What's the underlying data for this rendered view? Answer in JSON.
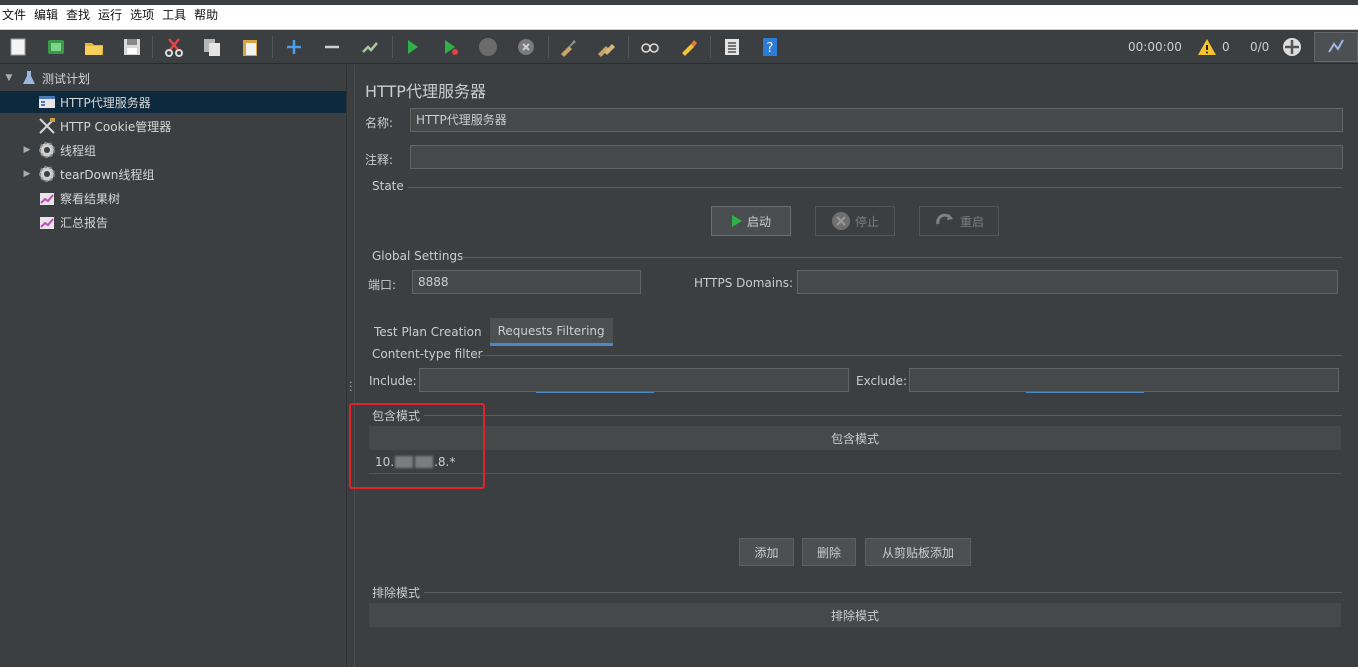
{
  "menu": [
    "文件",
    "编辑",
    "查找",
    "运行",
    "选项",
    "工具",
    "帮助"
  ],
  "toolbar_status": {
    "timer": "00:00:00",
    "warnings": "0",
    "threads": "0/0"
  },
  "tree": {
    "root": "测试计划",
    "items": [
      {
        "label": "HTTP代理服务器",
        "icon": "proxy-server-icon"
      },
      {
        "label": "HTTP Cookie管理器",
        "icon": "tools-icon"
      },
      {
        "label": "线程组",
        "icon": "gear-icon"
      },
      {
        "label": "tearDown线程组",
        "icon": "gear-icon"
      },
      {
        "label": "察看结果树",
        "icon": "chart-icon"
      },
      {
        "label": "汇总报告",
        "icon": "chart-icon"
      }
    ]
  },
  "panel": {
    "title": "HTTP代理服务器",
    "name_label": "名称:",
    "name_value": "HTTP代理服务器",
    "comment_label": "注释:",
    "comment_value": "",
    "state_label": "State",
    "start_label": "启动",
    "stop_label": "停止",
    "restart_label": "重启",
    "global_label": "Global Settings",
    "port_label": "端口:",
    "port_value": "8888",
    "https_label": "HTTPS Domains:",
    "https_value": "",
    "tabs": [
      "Test Plan Creation",
      "Requests Filtering"
    ],
    "content_filter_label": "Content-type filter",
    "include_label": "Include:",
    "include_value": "",
    "exclude_label": "Exclude:",
    "exclude_value": "",
    "include_patterns_label": "包含模式",
    "include_patterns_header": "包含模式",
    "include_pattern_prefix": "10.",
    "include_pattern_suffix": ".8.*",
    "add_label": "添加",
    "delete_label": "删除",
    "paste_label": "从剪贴板添加",
    "exclude_patterns_label": "排除模式",
    "exclude_patterns_header": "排除模式"
  }
}
